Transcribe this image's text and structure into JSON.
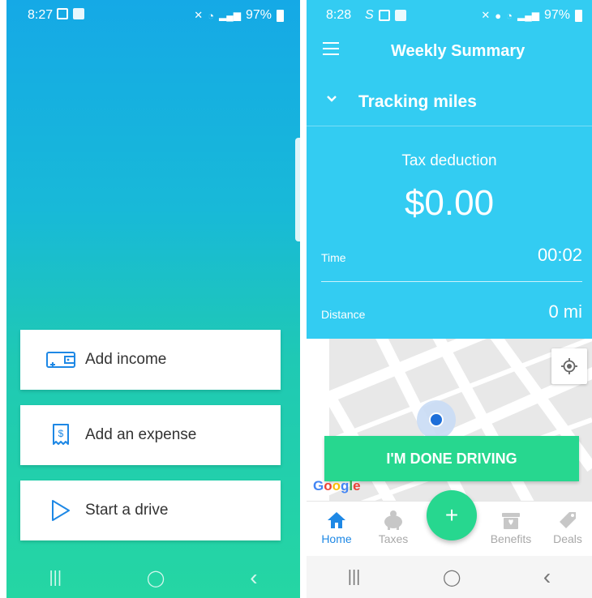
{
  "left_screen": {
    "status": {
      "time": "8:27",
      "battery": "97%"
    },
    "actions": [
      {
        "label": "Add income",
        "icon": "wallet-icon"
      },
      {
        "label": "Add an expense",
        "icon": "receipt-dollar-icon"
      },
      {
        "label": "Start a drive",
        "icon": "play-triangle-icon"
      }
    ],
    "nav": {
      "recents": "|||",
      "home": "◯",
      "back": "‹"
    }
  },
  "right_screen": {
    "status": {
      "time": "8:28",
      "battery": "97%"
    },
    "header": {
      "title": "Weekly Summary"
    },
    "tracking": {
      "label": "Tracking miles"
    },
    "summary": {
      "tax_label": "Tax deduction",
      "tax_value": "$0.00",
      "time_label": "Time",
      "time_value": "00:02",
      "distance_label": "Distance",
      "distance_value": "0 mi"
    },
    "done_button": "I'M DONE DRIVING",
    "map_logo": [
      "G",
      "o",
      "o",
      "g",
      "l",
      "e"
    ],
    "fab": "+",
    "tabs": [
      {
        "label": "Home",
        "icon": "home-icon",
        "active": true
      },
      {
        "label": "Taxes",
        "icon": "piggy-bank-icon",
        "active": false
      },
      {
        "label": "Benefits",
        "icon": "gift-box-icon",
        "active": false
      },
      {
        "label": "Deals",
        "icon": "tag-icon",
        "active": false
      }
    ],
    "nav": {
      "recents": "|||",
      "home": "◯",
      "back": "‹"
    }
  },
  "colors": {
    "left_gradient_top": "#15a9e6",
    "left_gradient_bottom": "#25d6a3",
    "right_header_blue": "#33ccf2",
    "accent_green": "#27d78f",
    "active_tab_blue": "#1e88e5"
  }
}
